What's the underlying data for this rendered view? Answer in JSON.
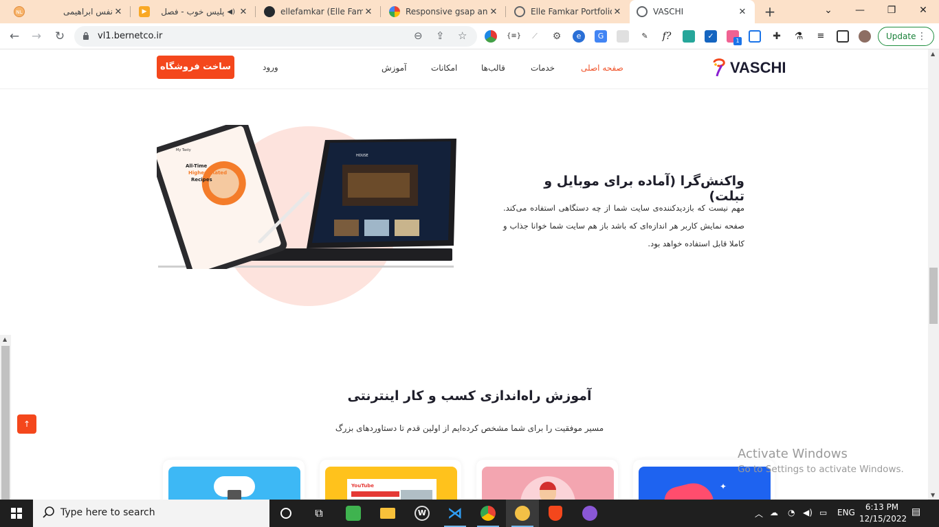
{
  "browser": {
    "tabs": [
      {
        "title": "نفس ابراهیمی",
        "icon": "nl-icon",
        "active": false
      },
      {
        "title": "پلیس خوب - فصل",
        "icon": "play-icon",
        "active": false
      },
      {
        "title": "ellefamkar (Elle Famkar)",
        "icon": "github-icon",
        "active": false
      },
      {
        "title": "Responsive gsap animation",
        "icon": "google-icon",
        "active": false
      },
      {
        "title": "Elle Famkar Portfolio |",
        "icon": "globe-icon",
        "active": false
      },
      {
        "title": "VASCHI",
        "icon": "globe-icon",
        "active": true
      }
    ],
    "url": "vl1.bernetco.ir",
    "update_label": "Update",
    "extension_badge": "1"
  },
  "site": {
    "logo": "VASCHI",
    "nav": {
      "home": "صفحه اصلی",
      "services": "خدمات",
      "templates": "قالب‌ها",
      "features": "امکانات",
      "tutorials": "آموزش"
    },
    "login": "ورود",
    "cta": "ساخت فروشگاه",
    "accent": "#f4471c"
  },
  "hero": {
    "title": "واکنش‌گرا (آماده برای موبایل و تبلت)",
    "text": "مهم نیست که بازدیدکننده‌ی سایت شما از چه دستگاهی استفاده می‌کند. صفحه نمایش کاربر هر اندازه‌ای که باشد باز هم سایت شما خوانا جذاب و کاملا قابل استفاده خواهد بود.",
    "tablet_left": {
      "lines": [
        "All-Time",
        "Highest Rated",
        "Recipes"
      ],
      "brand": "My Tasty"
    },
    "tablet_right": {
      "brand": "HOUSE"
    }
  },
  "learn": {
    "title": "آموزش راه‌اندازی کسب و کار اینترنتی",
    "subtitle": "مسیر موفقیت را برای شما مشخص کرده‌ایم از اولین قدم تا دستاوردهای بزرگ",
    "cards": [
      {
        "color": "#3db8f5",
        "icon": "cloud-icon"
      },
      {
        "color": "#ffc21c",
        "icon": "youtube-icon",
        "label": "YouTube"
      },
      {
        "color": "#f3a5b0",
        "icon": "delivery-person-icon"
      },
      {
        "color": "#1e63f0",
        "icon": "sneaker-icon"
      }
    ]
  },
  "watermark": {
    "line1": "Activate Windows",
    "line2": "Go to Settings to activate Windows."
  },
  "taskbar": {
    "search_placeholder": "Type here to search",
    "language": "ENG",
    "time": "6:13 PM",
    "date": "12/15/2022"
  }
}
